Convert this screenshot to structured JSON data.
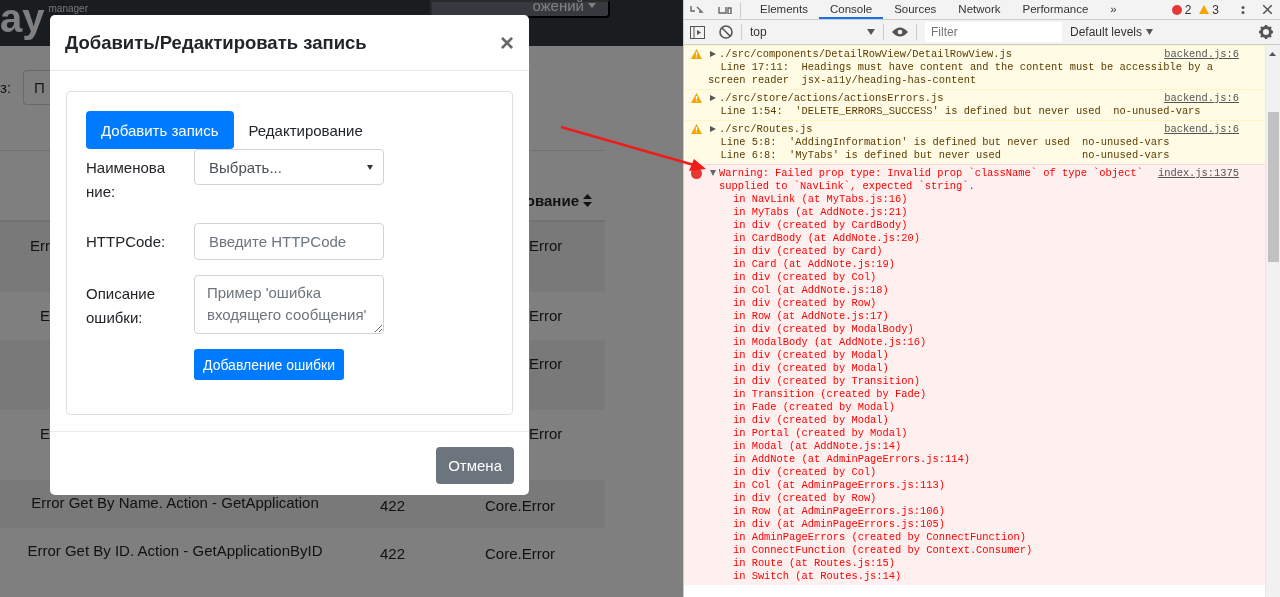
{
  "app": {
    "logo": "ay",
    "logo_caption": "manager",
    "dropdown": "ожений",
    "filter_label": "з:",
    "filter_placeholder": "П",
    "table": {
      "header": "ование",
      "rows": [
        {
          "kind": "covered",
          "left": "Err",
          "right": "Error"
        },
        {
          "kind": "covered",
          "left": "E",
          "right": "Error"
        },
        {
          "kind": "covered",
          "right": "Error"
        },
        {
          "kind": "covered",
          "left": "E",
          "right": "Error"
        },
        {
          "kind": "full",
          "cells": [
            "Error Get By Name. Action - GetApplication",
            "422",
            "Core.Error"
          ]
        },
        {
          "kind": "full",
          "cells": [
            "Error Get By ID. Action - GetApplicationByID",
            "422",
            "Core.Error"
          ]
        }
      ]
    }
  },
  "modal": {
    "title": "Добавить/Редактировать запись",
    "close": "×",
    "tabs": [
      {
        "label": "Добавить запись",
        "selected": true
      },
      {
        "label": "Редактирование",
        "selected": false
      }
    ],
    "fields": [
      {
        "kind": "select",
        "label": "Наименование:",
        "value": "Выбрать..."
      },
      {
        "kind": "input",
        "label": "HTTPCode:",
        "placeholder": "Введите HTTPCode"
      },
      {
        "kind": "textarea",
        "label": "Описание ошибки:",
        "placeholder": "Пример 'ошибка входящего сообщения'"
      }
    ],
    "submit": "Добавление ошибки",
    "cancel": "Отмена"
  },
  "devtools": {
    "tabs": [
      {
        "label": "Elements",
        "selected": false
      },
      {
        "label": "Console",
        "selected": true
      },
      {
        "label": "Sources",
        "selected": false
      },
      {
        "label": "Network",
        "selected": false
      },
      {
        "label": "Performance",
        "selected": false
      }
    ],
    "more": "»",
    "error_count": "2",
    "warning_count": "3",
    "context": "top",
    "filter_placeholder": "Filter",
    "levels": "Default levels",
    "messages": [
      {
        "kind": "warning",
        "expanded": false,
        "source": "./src/components/DetailRowView/DetailRowView.js",
        "link": "backend.js:6",
        "lines": [
          "Line 17:11:  Headings must have content and the content must be accessible by a screen reader  jsx-a11y/heading-has-content"
        ]
      },
      {
        "kind": "warning",
        "expanded": false,
        "source": "./src/store/actions/actionsErrors.js",
        "link": "backend.js:6",
        "lines": [
          "Line 1:54:  'DELETE_ERRORS_SUCCESS' is defined but never used  no-unused-vars"
        ]
      },
      {
        "kind": "warning",
        "expanded": false,
        "source": "./src/Routes.js",
        "link": "backend.js:6",
        "lines": [
          "Line 5:8:  'AddingInformation' is defined but never used  no-unused-vars",
          "Line 6:8:  'MyTabs' is defined but never used             no-unused-vars"
        ]
      },
      {
        "kind": "error",
        "expanded": true,
        "source": "Warning: Failed prop type: Invalid prop `className` of type `object` supplied to `NavLink`, expected `string`.",
        "link": "index.js:1375",
        "lines": [
          "in NavLink (at MyTabs.js:16)",
          "in MyTabs (at AddNote.js:21)",
          "in div (created by CardBody)",
          "in CardBody (at AddNote.js:20)",
          "in div (created by Card)",
          "in Card (at AddNote.js:19)",
          "in div (created by Col)",
          "in Col (at AddNote.js:18)",
          "in div (created by Row)",
          "in Row (at AddNote.js:17)",
          "in div (created by ModalBody)",
          "in ModalBody (at AddNote.js:16)",
          "in div (created by Modal)",
          "in div (created by Modal)",
          "in div (created by Transition)",
          "in Transition (created by Fade)",
          "in Fade (created by Modal)",
          "in div (created by Modal)",
          "in Portal (created by Modal)",
          "in Modal (at AddNote.js:14)",
          "in AddNote (at AdminPageErrors.js:114)",
          "in div (created by Col)",
          "in Col (at AdminPageErrors.js:113)",
          "in div (created by Row)",
          "in Row (at AdminPageErrors.js:106)",
          "in div (at AdminPageErrors.js:105)",
          "in AdminPageErrors (created by ConnectFunction)",
          "in ConnectFunction (created by Context.Consumer)",
          "in Route (at Routes.js:15)",
          "in Switch (at Routes.js:14)"
        ]
      }
    ]
  }
}
